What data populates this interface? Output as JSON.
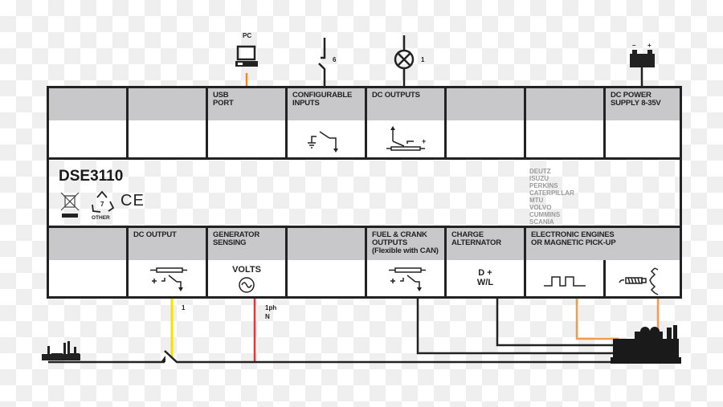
{
  "module": {
    "model": "DSE3110",
    "recycle_label": "OTHER",
    "recycle_code": "7",
    "ce_mark": "CE",
    "engine_brands": [
      "DEUTZ",
      "ISUZU",
      "PERKINS",
      "CATERPILLAR",
      "MTU",
      "VOLVO",
      "CUMMINS",
      "SCANIA"
    ]
  },
  "top_row": [
    {
      "label_lines": [
        "",
        ""
      ]
    },
    {
      "label_lines": [
        "",
        ""
      ]
    },
    {
      "label_lines": [
        "USB",
        "PORT"
      ]
    },
    {
      "label_lines": [
        "CONFIGURABLE",
        "INPUTS"
      ]
    },
    {
      "label_lines": [
        "DC OUTPUTS",
        ""
      ]
    },
    {
      "label_lines": [
        "",
        ""
      ]
    },
    {
      "label_lines": [
        "",
        ""
      ]
    },
    {
      "label_lines": [
        "DC POWER",
        "SUPPLY 8-35V"
      ]
    }
  ],
  "bottom_row": [
    {
      "label_lines": [
        "",
        "",
        ""
      ]
    },
    {
      "label_lines": [
        "DC OUTPUT",
        "",
        ""
      ]
    },
    {
      "label_lines": [
        "GENERATOR",
        "SENSING",
        ""
      ]
    },
    {
      "label_lines": [
        "",
        "",
        ""
      ]
    },
    {
      "label_lines": [
        "FUEL & CRANK",
        "OUTPUTS",
        "(Flexible with CAN)"
      ]
    },
    {
      "label_lines": [
        "CHARGE",
        "ALTERNATOR",
        ""
      ]
    },
    {
      "label_lines": [
        "ELECTRONIC ENGINES",
        "OR MAGNETIC PICK-UP",
        ""
      ]
    }
  ],
  "top_connections": {
    "pc_label": "PC",
    "inputs_count": "6",
    "outputs_count": "1",
    "battery_minus": "–",
    "battery_plus": "+"
  },
  "cell_content": {
    "volts_label": "VOLTS",
    "charge_line1": "D +",
    "charge_line2": "W/L",
    "dc_output_plus": "+"
  },
  "bottom_connections": {
    "dc_output_count": "1",
    "sensing_line1": "1ph",
    "sensing_line2": "N"
  },
  "colors": {
    "usb_wire": "#f08a24",
    "dc_output_wire": "#f5e100",
    "sensing_wire": "#e8333c",
    "pickup_wire": "#f59a4a",
    "header_fill": "#c8c8ca",
    "line": "#222222"
  }
}
